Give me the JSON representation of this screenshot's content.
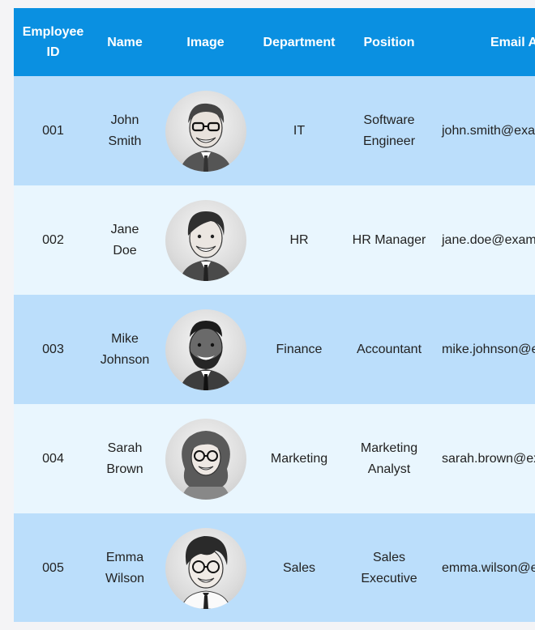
{
  "table": {
    "headers": {
      "id": "Employee ID",
      "name": "Name",
      "image": "Image",
      "department": "Department",
      "position": "Position",
      "email": "Email Address"
    },
    "rows": [
      {
        "id": "001",
        "name": "John Smith",
        "avatar": "man-with-glasses-avatar",
        "department": "IT",
        "position": "Software Engineer",
        "email": "john.smith@example.com"
      },
      {
        "id": "002",
        "name": "Jane Doe",
        "avatar": "man-smiling-avatar",
        "department": "HR",
        "position": "HR Manager",
        "email": "jane.doe@example.com"
      },
      {
        "id": "003",
        "name": "Mike Johnson",
        "avatar": "man-with-beard-avatar",
        "department": "Finance",
        "position": "Accountant",
        "email": "mike.johnson@example.com"
      },
      {
        "id": "004",
        "name": "Sarah Brown",
        "avatar": "woman-with-glasses-avatar",
        "department": "Marketing",
        "position": "Marketing Analyst",
        "email": "sarah.brown@example.com"
      },
      {
        "id": "005",
        "name": "Emma Wilson",
        "avatar": "child-with-glasses-avatar",
        "department": "Sales",
        "position": "Sales Executive",
        "email": "emma.wilson@example.com"
      }
    ]
  },
  "colors": {
    "header_bg": "#0a90e1",
    "row_odd": "#bbdefb",
    "row_even": "#e9f6fe"
  }
}
